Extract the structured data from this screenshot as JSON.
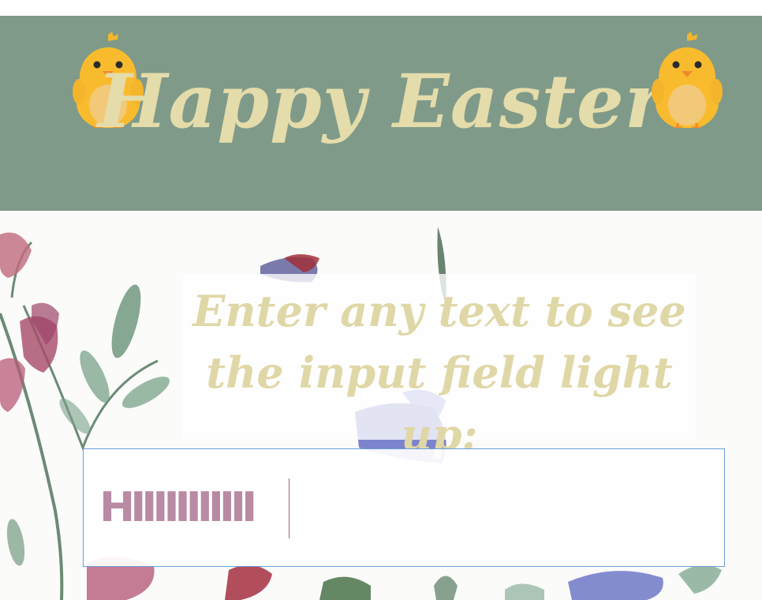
{
  "header": {
    "title": "Happy Easter",
    "left_icon": "chick-icon",
    "right_icon": "chick-icon",
    "background_color": "#7f9a89",
    "title_color": "#e4dcaa"
  },
  "main": {
    "prompt": "Enter any text to see the input field light up:",
    "prompt_color": "#e0d7a7",
    "background": "watercolor-flowers"
  },
  "input": {
    "value": "HIIIIIIIIIII",
    "text_color": "#b88aa4",
    "border_color": "#6a9ed8"
  }
}
